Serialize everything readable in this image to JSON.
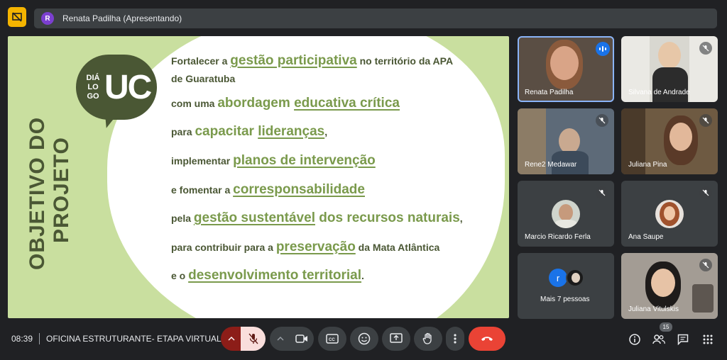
{
  "header": {
    "presenter_initial": "R",
    "presenting_text": "Renata Padilha (Apresentando)"
  },
  "slide": {
    "vertical_title_line1": "OBJETIVO DO",
    "vertical_title_line2": "PROJETO",
    "logo_small_1": "DIÁ",
    "logo_small_2": "LO",
    "logo_small_3": "GO",
    "logo_big": "UC",
    "lines": [
      {
        "pre": "Fortalecer a ",
        "hl": "gestão participativa",
        "post": " no território da APA"
      },
      {
        "pre": "de Guaratuba",
        "hl": "",
        "post": ""
      },
      {
        "pre": "com uma ",
        "hl_plain": "abordagem ",
        "hl": "educativa crítica",
        "post": ""
      },
      {
        "pre": "para ",
        "hl_plain": "capacitar ",
        "hl": "lideranças",
        "post": ","
      },
      {
        "pre": "implementar ",
        "hl": "planos de intervenção",
        "post": ""
      },
      {
        "pre": "e fomentar a ",
        "hl": "corresponsabilidade",
        "post": ""
      },
      {
        "pre": "pela ",
        "hl": "gestão sustentável",
        "hl_after": " dos recursos naturais",
        "post": ","
      },
      {
        "pre": "para contribuir para a ",
        "hl": "preservação",
        "post": " da Mata Atlântica"
      },
      {
        "pre": "e o ",
        "hl": "desenvolvimento territorial",
        "post": "."
      }
    ]
  },
  "participants": [
    {
      "name": "Renata Padilha",
      "state": "speaking"
    },
    {
      "name": "Silvana de Andrade",
      "state": "muted"
    },
    {
      "name": "Rene2 Medawar",
      "state": "muted"
    },
    {
      "name": "Juliana Pina",
      "state": "muted"
    },
    {
      "name": "Marcio Ricardo Ferla",
      "state": "muted"
    },
    {
      "name": "Ana Saupe",
      "state": "muted"
    },
    {
      "name": "Mais 7 pessoas",
      "initial": "r"
    },
    {
      "name": "Juliana Vitulskis",
      "state": "muted"
    }
  ],
  "footer": {
    "time": "08:39",
    "separator": "|",
    "meeting_name": "OFICINA ESTRUTURANTE- ETAPA VIRTUAL",
    "people_count": "15"
  },
  "colors": {
    "slide_green": "#c9df9f",
    "text_dark_green": "#4a5734",
    "highlight_green": "#7a9a4c",
    "end_call_red": "#ea4335",
    "accent_blue": "#1a73e8"
  }
}
